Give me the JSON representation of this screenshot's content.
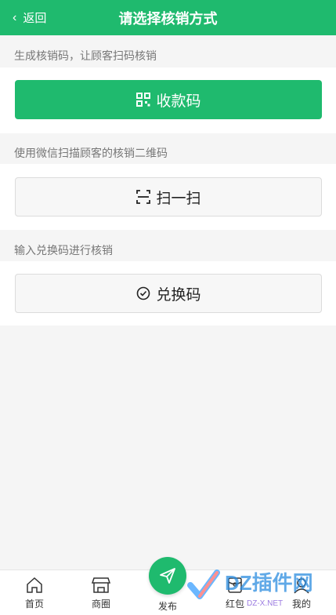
{
  "header": {
    "back_label": "返回",
    "title": "请选择核销方式"
  },
  "sections": {
    "generate_label": "生成核销码，让顾客扫码核销",
    "generate_button": "收款码",
    "scan_label": "使用微信扫描顾客的核销二维码",
    "scan_button": "扫一扫",
    "redeem_label": "输入兑换码进行核销",
    "redeem_button": "兑换码"
  },
  "tabbar": {
    "home": "首页",
    "mall": "商圈",
    "publish": "发布",
    "redpacket": "红包",
    "mine": "我的"
  },
  "watermark": {
    "text": "DZ插件网",
    "sub": "DZ-X.NET"
  },
  "colors": {
    "accent": "#1fba6e"
  }
}
